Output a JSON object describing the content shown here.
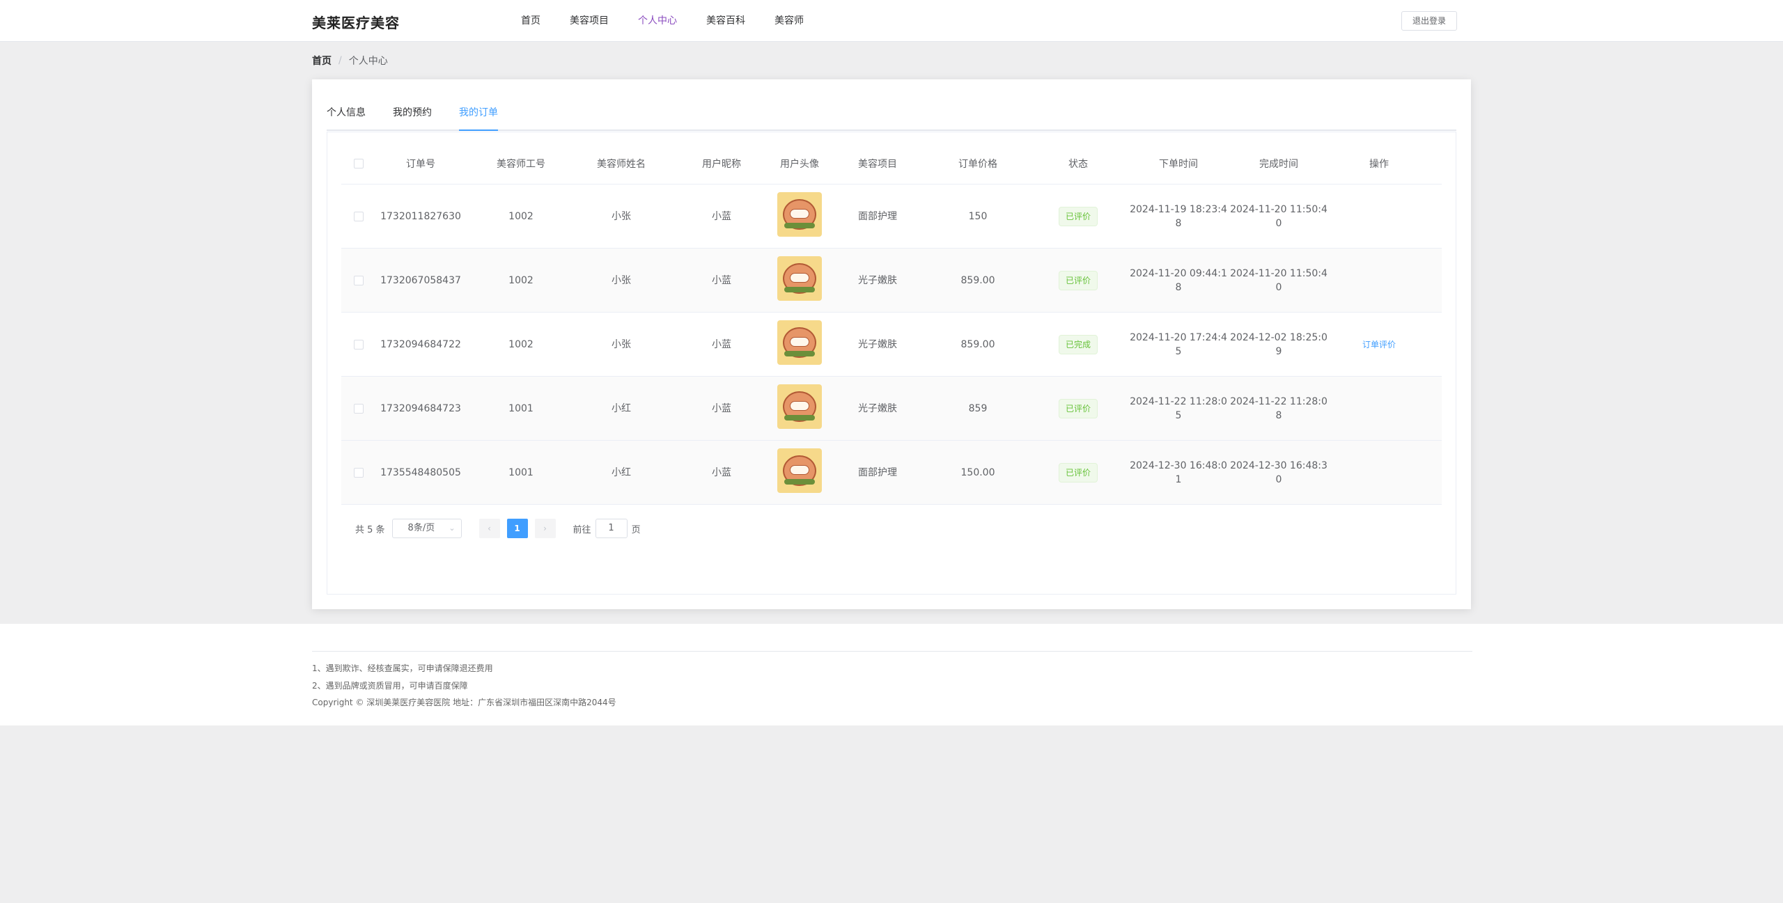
{
  "header": {
    "brand": "美莱医疗美容",
    "nav": [
      "首页",
      "美容项目",
      "个人中心",
      "美容百科",
      "美容师"
    ],
    "active_nav": "个人中心",
    "logout_label": "退出登录"
  },
  "breadcrumb": {
    "home": "首页",
    "separator": "/",
    "current": "个人中心"
  },
  "tabs": [
    "个人信息",
    "我的预约",
    "我的订单"
  ],
  "active_tab": "我的订单",
  "table": {
    "headers": [
      "订单号",
      "美容师工号",
      "美容师姓名",
      "用户昵称",
      "用户头像",
      "美容项目",
      "订单价格",
      "状态",
      "下单时间",
      "完成时间",
      "操作"
    ],
    "rows": [
      {
        "order_no": "1732011827630",
        "beautician_id": "1002",
        "beautician_name": "小张",
        "nickname": "小蓝",
        "project": "面部护理",
        "price": "150",
        "status": "已评价",
        "order_time": "2024-11-19 18:23:4",
        "order_time_tail": "8",
        "finish_time": "2024-11-20 11:50:4",
        "finish_time_tail": "0",
        "action": ""
      },
      {
        "order_no": "1732067058437",
        "beautician_id": "1002",
        "beautician_name": "小张",
        "nickname": "小蓝",
        "project": "光子嫩肤",
        "price": "859.00",
        "status": "已评价",
        "order_time": "2024-11-20 09:44:1",
        "order_time_tail": "8",
        "finish_time": "2024-11-20 11:50:4",
        "finish_time_tail": "0",
        "action": ""
      },
      {
        "order_no": "1732094684722",
        "beautician_id": "1002",
        "beautician_name": "小张",
        "nickname": "小蓝",
        "project": "光子嫩肤",
        "price": "859.00",
        "status": "已完成",
        "order_time": "2024-11-20 17:24:4",
        "order_time_tail": "5",
        "finish_time": "2024-12-02 18:25:0",
        "finish_time_tail": "9",
        "action": "订单评价"
      },
      {
        "order_no": "1732094684723",
        "beautician_id": "1001",
        "beautician_name": "小红",
        "nickname": "小蓝",
        "project": "光子嫩肤",
        "price": "859",
        "status": "已评价",
        "order_time": "2024-11-22 11:28:0",
        "order_time_tail": "5",
        "finish_time": "2024-11-22 11:28:0",
        "finish_time_tail": "8",
        "action": ""
      },
      {
        "order_no": "1735548480505",
        "beautician_id": "1001",
        "beautician_name": "小红",
        "nickname": "小蓝",
        "project": "面部护理",
        "price": "150.00",
        "status": "已评价",
        "order_time": "2024-12-30 16:48:0",
        "order_time_tail": "1",
        "finish_time": "2024-12-30 16:48:3",
        "finish_time_tail": "0",
        "action": ""
      }
    ]
  },
  "pagination": {
    "total_label": "共 5 条",
    "page_size": "8条/页",
    "prev_icon": "‹",
    "next_icon": "›",
    "current_page": "1",
    "goto_label": "前往",
    "goto_value": "1",
    "page_unit": "页"
  },
  "footer": {
    "line1": "1、遇到欺诈、经核查属实，可申请保障退还费用",
    "line2": "2、遇到品牌或资质冒用，可申请百度保障",
    "copyright": "Copyright © 深圳美莱医疗美容医院 地址：广东省深圳市福田区深南中路2044号"
  },
  "colors": {
    "accent": "#409eff",
    "nav_active": "#8a4bbf",
    "status_green": "#67c23a"
  }
}
